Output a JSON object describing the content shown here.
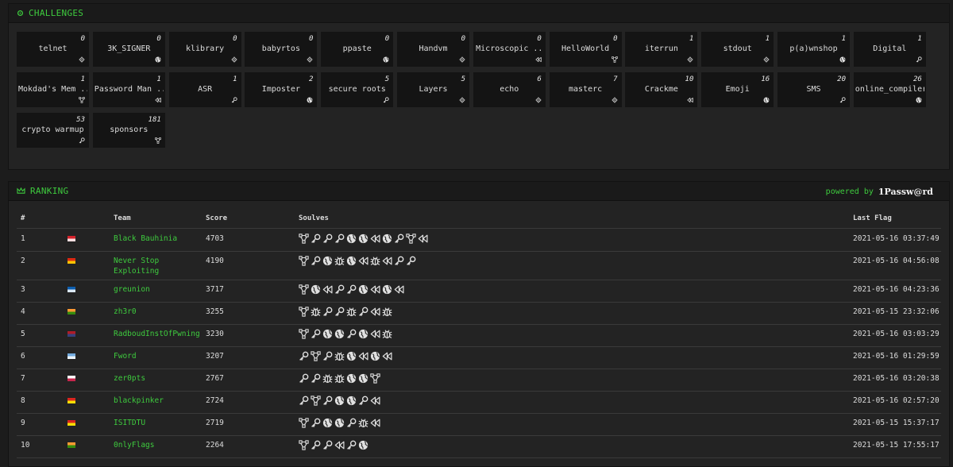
{
  "challenges_panel": {
    "title": "CHALLENGES"
  },
  "challenges": [
    {
      "name": "telnet",
      "solves": "0",
      "icon": "gear"
    },
    {
      "name": "3K_SIGNER",
      "solves": "0",
      "icon": "globe"
    },
    {
      "name": "klibrary",
      "solves": "0",
      "icon": "gear"
    },
    {
      "name": "babyrtos",
      "solves": "0",
      "icon": "gear"
    },
    {
      "name": "ppaste",
      "solves": "0",
      "icon": "globe"
    },
    {
      "name": "Handvm",
      "solves": "0",
      "icon": "gear"
    },
    {
      "name": "Microscopic ..",
      "solves": "0",
      "icon": "rewind"
    },
    {
      "name": "HelloWorld",
      "solves": "0",
      "icon": "network"
    },
    {
      "name": "iterrun",
      "solves": "1",
      "icon": "gear"
    },
    {
      "name": "stdout",
      "solves": "1",
      "icon": "gear"
    },
    {
      "name": "p(a)wnshop",
      "solves": "1",
      "icon": "globe"
    },
    {
      "name": "Digital",
      "solves": "1",
      "icon": "key"
    },
    {
      "name": "Mokdad's Mem ..",
      "solves": "1",
      "icon": "network"
    },
    {
      "name": "Password Man ..",
      "solves": "1",
      "icon": "rewind"
    },
    {
      "name": "ASR",
      "solves": "1",
      "icon": "key"
    },
    {
      "name": "Imposter",
      "solves": "2",
      "icon": "globe"
    },
    {
      "name": "secure roots",
      "solves": "5",
      "icon": "key"
    },
    {
      "name": "Layers",
      "solves": "5",
      "icon": "gear"
    },
    {
      "name": "echo",
      "solves": "6",
      "icon": "gear"
    },
    {
      "name": "masterc",
      "solves": "7",
      "icon": "gear"
    },
    {
      "name": "Crackme",
      "solves": "10",
      "icon": "rewind"
    },
    {
      "name": "Emoji",
      "solves": "16",
      "icon": "globe"
    },
    {
      "name": "SMS",
      "solves": "20",
      "icon": "key"
    },
    {
      "name": "online_compiler",
      "solves": "26",
      "icon": "globe"
    },
    {
      "name": "crypto warmup",
      "solves": "53",
      "icon": "key"
    },
    {
      "name": "sponsors",
      "solves": "181",
      "icon": "network"
    }
  ],
  "ranking_panel": {
    "title": "RANKING",
    "powered_by": "powered by",
    "sponsor": "1Passw@rd"
  },
  "table_headers": {
    "rank": "#",
    "team": "Team",
    "score": "Score",
    "solves": "Soulves",
    "last_flag": "Last Flag"
  },
  "ranking": [
    {
      "rank": "1",
      "flag": [
        "#d4222b",
        "#ffffff"
      ],
      "team": "Black Bauhinia",
      "score": "4703",
      "solves": [
        "network",
        "key",
        "key",
        "key",
        "globe",
        "globe",
        "rewind",
        "globe",
        "key",
        "network",
        "rewind"
      ],
      "last": "2021-05-16 03:37:49"
    },
    {
      "rank": "2",
      "flag": [
        "#de2910",
        "#ffde00"
      ],
      "team": "Never Stop Exploiting",
      "score": "4190",
      "solves": [
        "network",
        "key",
        "globe",
        "bug",
        "globe",
        "rewind",
        "bug",
        "rewind",
        "key",
        "key"
      ],
      "last": "2021-05-16 04:56:08"
    },
    {
      "rank": "3",
      "flag": [
        "#0d5eaf",
        "#ffffff"
      ],
      "team": "greunion",
      "score": "3717",
      "solves": [
        "network",
        "globe",
        "rewind",
        "key",
        "key",
        "globe",
        "rewind",
        "globe",
        "rewind"
      ],
      "last": "2021-05-16 04:23:36"
    },
    {
      "rank": "4",
      "flag": [
        "#ff9933",
        "#138808"
      ],
      "team": "zh3r0",
      "score": "3255",
      "solves": [
        "network",
        "bug",
        "key",
        "key",
        "bug",
        "key",
        "rewind",
        "bug"
      ],
      "last": "2021-05-15 23:32:06"
    },
    {
      "rank": "5",
      "flag": [
        "#ae1c28",
        "#21468b"
      ],
      "team": "RadboudInstOfPwning",
      "score": "3230",
      "solves": [
        "network",
        "key",
        "globe",
        "globe",
        "key",
        "globe",
        "rewind",
        "bug"
      ],
      "last": "2021-05-16 03:03:29"
    },
    {
      "rank": "6",
      "flag": [
        "#74acdf",
        "#ffffff"
      ],
      "team": "Fword",
      "score": "3207",
      "solves": [
        "key",
        "network",
        "key",
        "bug",
        "globe",
        "rewind",
        "globe",
        "rewind"
      ],
      "last": "2021-05-16 01:29:59"
    },
    {
      "rank": "7",
      "flag": [
        "#ffffff",
        "#bc002d"
      ],
      "team": "zer0pts",
      "score": "2767",
      "solves": [
        "key",
        "key",
        "bug",
        "bug",
        "globe",
        "globe",
        "network"
      ],
      "last": "2021-05-16 03:20:38"
    },
    {
      "rank": "8",
      "flag": [
        "#da251d",
        "#ffff00"
      ],
      "team": "blackpinker",
      "score": "2724",
      "solves": [
        "key",
        "network",
        "key",
        "globe",
        "globe",
        "key",
        "rewind"
      ],
      "last": "2021-05-16 02:57:20"
    },
    {
      "rank": "9",
      "flag": [
        "#da251d",
        "#ffff00"
      ],
      "team": "ISITDTU",
      "score": "2719",
      "solves": [
        "network",
        "key",
        "globe",
        "globe",
        "key",
        "bug",
        "rewind"
      ],
      "last": "2021-05-15 15:37:17"
    },
    {
      "rank": "10",
      "flag": [
        "#ff9933",
        "#138808"
      ],
      "team": "0nlyFlags",
      "score": "2264",
      "solves": [
        "network",
        "key",
        "key",
        "rewind",
        "key",
        "globe"
      ],
      "last": "2021-05-15 17:55:17"
    }
  ]
}
